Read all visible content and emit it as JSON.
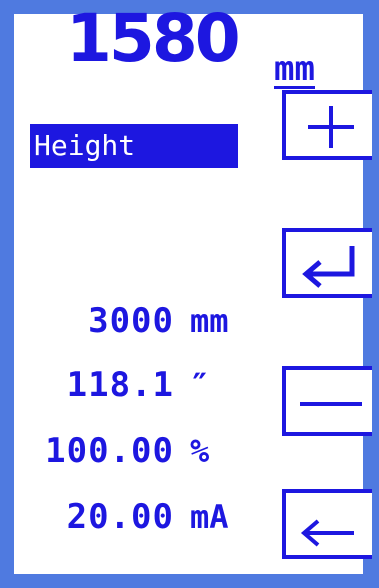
{
  "display": {
    "main_value": "1580",
    "main_unit": "mm",
    "parameter_label": "Height"
  },
  "readings": [
    {
      "value": "3000",
      "unit": "mm"
    },
    {
      "value": "118.1",
      "unit": "″"
    },
    {
      "value": "100.00",
      "unit": "%"
    },
    {
      "value": "20.00",
      "unit": "mA"
    }
  ],
  "buttons": {
    "plus": "plus-icon",
    "enter": "enter-arrow-icon",
    "minus": "minus-icon",
    "back": "back-arrow-icon"
  },
  "colors": {
    "frame": "#4f7ae0",
    "text": "#1d17e0",
    "background": "#ffffff"
  }
}
